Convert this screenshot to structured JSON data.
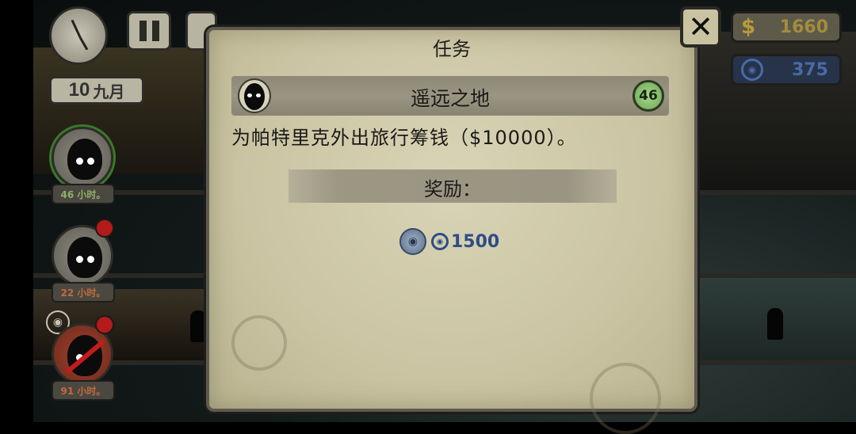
{
  "hud": {
    "date_day": "10",
    "date_month": "九月",
    "money": "1660",
    "money_symbol": "$",
    "tokens": "375"
  },
  "tenants": [
    {
      "hours": "46 小时。"
    },
    {
      "hours": "22 小时。"
    },
    {
      "hours": "91 小时。"
    }
  ],
  "modal": {
    "title": "任务",
    "quest_name": "遥远之地",
    "quest_hours": "46",
    "description": "为帕特里克外出旅行筹钱（$10000）。",
    "reward_label": "奖励：",
    "reward_amount": "1500"
  },
  "colors": {
    "parchment": "#cac4a3",
    "reward_blue": "#2f4c85",
    "hours_green": "#8fb16a",
    "hours_orange": "#c36a3c"
  }
}
